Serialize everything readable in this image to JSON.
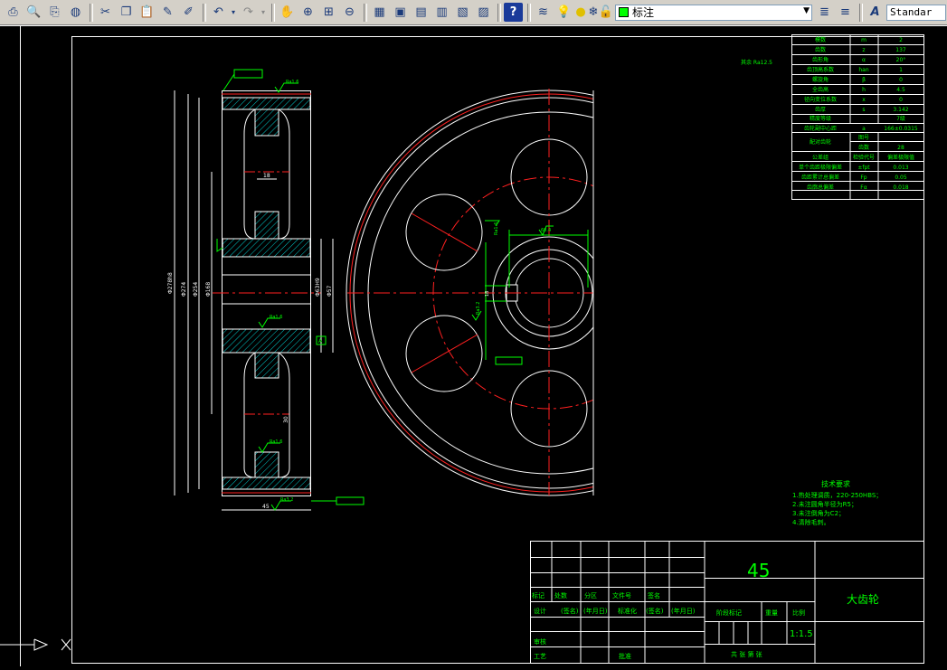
{
  "toolbar": {
    "layer_name": "标注",
    "text_style": "Standar"
  },
  "params": [
    [
      "模数",
      "m",
      "2"
    ],
    [
      "齿数",
      "z",
      "137"
    ],
    [
      "齿形角",
      "α",
      "20°"
    ],
    [
      "齿顶高系数",
      "han",
      "1"
    ],
    [
      "螺旋角",
      "β",
      "0"
    ],
    [
      "全齿高",
      "h",
      "4.5"
    ],
    [
      "径向变位系数",
      "x",
      "0"
    ],
    [
      "齿厚",
      "s",
      "3.142"
    ]
  ],
  "accuracy_label": "精度等级",
  "accuracy_value": "7级",
  "center_label": "齿轮副中心距",
  "center_sym": "a",
  "center_value": "166±0.0315",
  "pair_label": "配对齿轮",
  "pair_row1": [
    "图号",
    ""
  ],
  "pair_row2": [
    "齿数",
    "28"
  ],
  "tol_header": [
    "公差组",
    "检验代号",
    "偏差极限值"
  ],
  "tol_rows": [
    [
      "单个齿距极限偏差",
      "±fpt",
      "0.013"
    ],
    [
      "齿距累计总偏差",
      "Fp",
      "0.05"
    ],
    [
      "齿廓总偏差",
      "Fα",
      "0.018"
    ]
  ],
  "roughness_note": "其余 Ra12.5",
  "tech_title": "技术要求",
  "tech_lines": [
    "1.热处理调质，220-250HBS；",
    "2.未注圆角半径为R5；",
    "3.未注倒角为C2；",
    "4.清除毛刺。"
  ],
  "title_block": {
    "material": "45",
    "part_name": "大齿轮",
    "scale": "1:1.5",
    "row_labels": [
      "标记",
      "处数",
      "分区",
      "文件号",
      "签名"
    ],
    "design": "设计",
    "sign_date_1": "(签名)",
    "date_1": "(年月日)",
    "standardize": "标准化",
    "sign_date_2": "(签名)",
    "date_2": "(年月日)",
    "review": "审核",
    "process": "工艺",
    "approve": "批准",
    "stage_mark": "阶段标记",
    "weight": "重量",
    "ratio": "比例",
    "sheets": "共  张  第  张"
  },
  "dims": {
    "d1": "Φ278h8",
    "d2": "Φ274",
    "d3": "Φ254",
    "d4": "Φ168",
    "d5": "Φ57",
    "d6": "Φ63H9",
    "datum": "A",
    "ra_top": "Ra1.6",
    "ra_mid": "Ra1.6",
    "ra_bot": "Ra1.6",
    "ra_face": "Ra3.2",
    "ra_hole": "Ra1.6",
    "ra_key": "Ra3.2",
    "width": "45",
    "web": "18",
    "key_w": "18",
    "key_d": "60.4",
    "hub_len": "30"
  },
  "colors": {
    "outline": "#ffffff",
    "center": "#ff2020",
    "dim": "#00ff00",
    "hatch": "#00c8c8"
  }
}
